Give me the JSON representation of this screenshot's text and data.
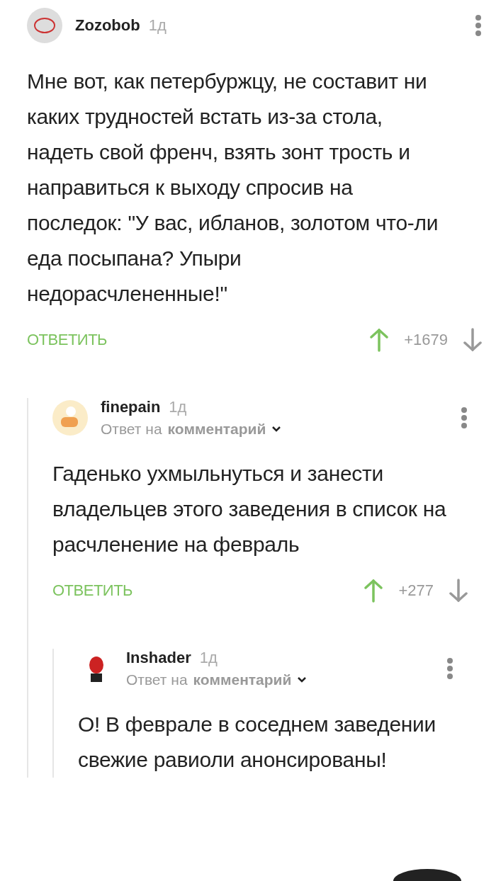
{
  "comment": {
    "author": "Zozobob",
    "time": "1д",
    "text": "Мне вот, как петербуржцу, не составит ни каких трудностей встать из-за стола, надеть свой френч, взять зонт трость и направиться к выходу спросив на последок: \"У вас, ибланов, золотом что-ли еда посыпана? Упыри недорасчлененные!\"",
    "reply_label": "ОТВЕТИТЬ",
    "score": "+1679",
    "voted_up": true,
    "children": [
      {
        "author": "finepain",
        "time": "1д",
        "reply_prefix": "Ответ на",
        "reply_target": "комментарий",
        "text": "Гаденько ухмыльнуться и занести владельцев этого заведения в список на расчленение на февраль",
        "reply_label": "ОТВЕТИТЬ",
        "score": "+277",
        "voted_up": true,
        "children": [
          {
            "author": "Inshader",
            "time": "1д",
            "reply_prefix": "Ответ на",
            "reply_target": "комментарий",
            "text": "О! В феврале в соседнем заведении свежие равиоли анонсированы!"
          }
        ]
      }
    ]
  }
}
